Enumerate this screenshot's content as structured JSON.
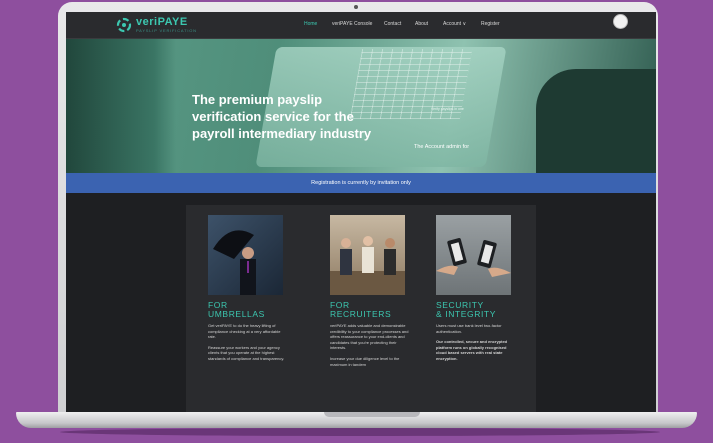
{
  "brand": {
    "name": "veriPAYE",
    "tagline": "PAYSLIP VERIFICATION",
    "accent": "#3cc7b0",
    "banner_color": "#3b63b1"
  },
  "nav": {
    "items": [
      "Home",
      "veriPAYE Console",
      "Contact",
      "About",
      "Account ∨",
      "Register"
    ],
    "active_index": 0
  },
  "hero": {
    "title": "The premium payslip verification service for the payroll intermediary industry",
    "note": "The Account admin for",
    "small_note": "Verify payslips in one"
  },
  "banner": {
    "text": "Registration is currently by invitation only"
  },
  "cards": [
    {
      "title_line1": "FOR",
      "title_line2": "UMBRELLAS",
      "image_icon": "businessman-umbrella-photo",
      "paragraphs": [
        "Get veriPAYE to do the heavy lifting of compliance checking at a very affordable rate.",
        "Reassure your workers and your agency clients that you operate at the highest standards of compliance and transparency."
      ]
    },
    {
      "title_line1": "FOR",
      "title_line2": "RECRUITERS",
      "image_icon": "candidates-waiting-photo",
      "paragraphs": [
        "veriPAYE adds valuable and demonstrable credibility to your compliance processes and offers reassurance to your end-clients and candidates that you're protecting their interests.",
        "Increase your due diligence level to the maximum in tandem"
      ]
    },
    {
      "title_line1": "SECURITY",
      "title_line2": "& INTEGRITY",
      "image_icon": "phones-handshake-photo",
      "paragraphs": [
        "Users must use bank level two-factor authentication.",
        "Our controlled, secure and encrypted platform runs on globally recognised cloud based servers with real state encryption."
      ]
    }
  ]
}
